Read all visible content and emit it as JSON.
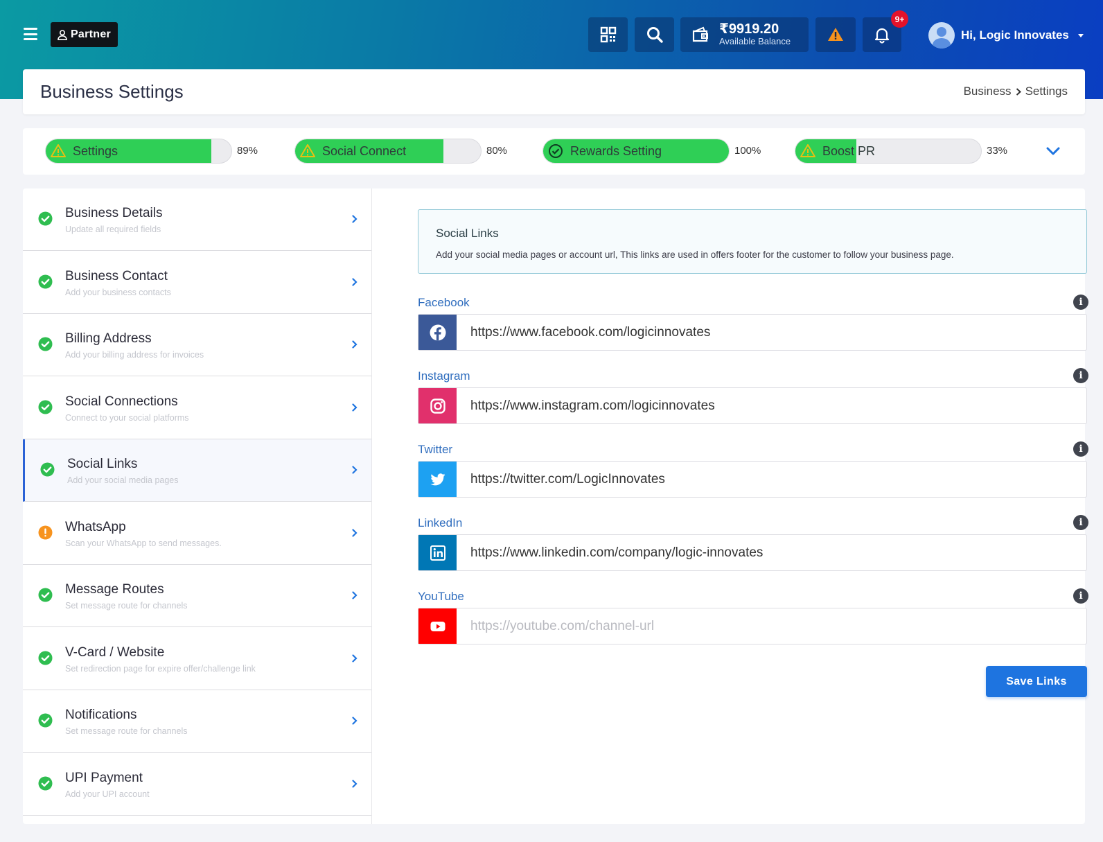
{
  "topbar": {
    "partner_label": "Partner",
    "wallet_amount": "₹9919.20",
    "wallet_label": "Available Balance",
    "notifications_badge": "9+",
    "user_greeting": "Hi, Logic Innovates"
  },
  "header": {
    "title": "Business Settings",
    "breadcrumb": [
      "Business",
      "Settings"
    ]
  },
  "progress": [
    {
      "label": "Settings",
      "percent_text": "89%",
      "status": "warning",
      "fill": 0.89
    },
    {
      "label": "Social Connect",
      "percent_text": "80%",
      "status": "warning",
      "fill": 0.8
    },
    {
      "label": "Rewards Setting",
      "percent_text": "100%",
      "status": "complete",
      "fill": 1.0
    },
    {
      "label": "Boost PR",
      "percent_text": "33%",
      "status": "warning",
      "fill": 0.33
    }
  ],
  "sidebar": {
    "items": [
      {
        "title": "Business Details",
        "subtitle": "Update all required fields",
        "status": "complete"
      },
      {
        "title": "Business Contact",
        "subtitle": "Add your business contacts",
        "status": "complete"
      },
      {
        "title": "Billing Address",
        "subtitle": "Add your billing address for invoices",
        "status": "complete"
      },
      {
        "title": "Social Connections",
        "subtitle": "Connect to your social platforms",
        "status": "complete"
      },
      {
        "title": "Social Links",
        "subtitle": "Add your social media pages",
        "status": "complete",
        "active": true
      },
      {
        "title": "WhatsApp",
        "subtitle": "Scan your WhatsApp to send messages.",
        "status": "warning"
      },
      {
        "title": "Message Routes",
        "subtitle": "Set message route for channels",
        "status": "complete"
      },
      {
        "title": "V-Card / Website",
        "subtitle": "Set redirection page for expire offer/challenge link",
        "status": "complete"
      },
      {
        "title": "Notifications",
        "subtitle": "Set message route for channels",
        "status": "complete"
      },
      {
        "title": "UPI Payment",
        "subtitle": "Add your UPI account",
        "status": "complete"
      }
    ]
  },
  "social_links": {
    "title": "Social Links",
    "description": "Add your social media pages or account url, This links are used in offers footer for the customer to follow your business page.",
    "fields": [
      {
        "label": "Facebook",
        "value": "https://www.facebook.com/logicinnovates",
        "placeholder": "",
        "icon": "facebook-icon",
        "color": "#3b5998"
      },
      {
        "label": "Instagram",
        "value": "https://www.instagram.com/logicinnovates",
        "placeholder": "",
        "icon": "instagram-icon",
        "color": "#e1306c"
      },
      {
        "label": "Twitter",
        "value": "https://twitter.com/LogicInnovates",
        "placeholder": "",
        "icon": "twitter-icon",
        "color": "#1da1f2"
      },
      {
        "label": "LinkedIn",
        "value": "https://www.linkedin.com/company/logic-innovates",
        "placeholder": "",
        "icon": "linkedin-icon",
        "color": "#0077b5"
      },
      {
        "label": "YouTube",
        "value": "",
        "placeholder": "https://youtube.com/channel-url",
        "icon": "youtube-icon",
        "color": "#ff0000"
      }
    ],
    "save_label": "Save Links"
  },
  "colors": {
    "accent": "#1e74e0",
    "success": "#2fcf56",
    "warning": "#f7931e"
  }
}
